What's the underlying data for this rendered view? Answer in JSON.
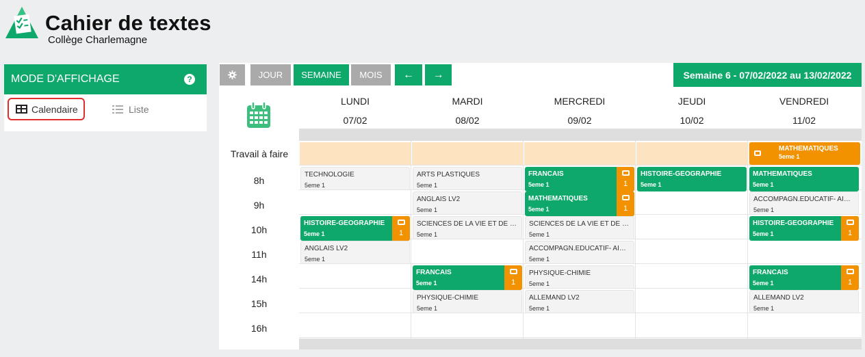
{
  "header": {
    "title": "Cahier de textes",
    "subtitle": "Collège Charlemagne"
  },
  "sidebar": {
    "title": "MODE D'AFFICHAGE",
    "help": "?",
    "views": [
      {
        "label": "Calendaire",
        "icon": "calendar-grid-icon",
        "selected": true
      },
      {
        "label": "Liste",
        "icon": "list-icon",
        "selected": false
      }
    ]
  },
  "toolbar": {
    "settings_icon": "gear-icon",
    "day": "JOUR",
    "week": "SEMAINE",
    "month": "MOIS",
    "prev": "←",
    "next": "→",
    "active_view": "SEMAINE"
  },
  "week_label": "Semaine 6 - 07/02/2022 au 13/02/2022",
  "colors": {
    "accent": "#0fa86b",
    "homework": "#f39200",
    "todo_row": "#fde3c0",
    "selection_outline": "#e22b2b"
  },
  "days": [
    {
      "name": "LUNDI",
      "date": "07/02"
    },
    {
      "name": "MARDI",
      "date": "08/02"
    },
    {
      "name": "MERCREDI",
      "date": "09/02"
    },
    {
      "name": "JEUDI",
      "date": "10/02"
    },
    {
      "name": "VENDREDI",
      "date": "11/02"
    }
  ],
  "rows": {
    "todo": "Travail à faire",
    "hours": [
      "8h",
      "9h",
      "10h",
      "11h",
      "14h",
      "15h",
      "16h"
    ]
  },
  "todo_items": [
    {
      "day": 4,
      "subject": "MATHEMATIQUES",
      "class": "5eme 1"
    }
  ],
  "lessons": [
    {
      "day": 0,
      "slot": 0,
      "subject": "TECHNOLOGIE",
      "class": "5eme 1",
      "homework": null
    },
    {
      "day": 0,
      "slot": 2,
      "subject": "HISTOIRE-GEOGRAPHIE",
      "class": "5eme 1",
      "homework": "1"
    },
    {
      "day": 0,
      "slot": 3,
      "subject": "ANGLAIS LV2",
      "class": "5eme 1",
      "homework": null
    },
    {
      "day": 1,
      "slot": 0,
      "subject": "ARTS PLASTIQUES",
      "class": "5eme 1",
      "homework": null
    },
    {
      "day": 1,
      "slot": 1,
      "subject": "ANGLAIS LV2",
      "class": "5eme 1",
      "homework": null
    },
    {
      "day": 1,
      "slot": 2,
      "subject": "SCIENCES DE LA VIE ET DE LA TER...",
      "class": "5eme 1",
      "homework": null
    },
    {
      "day": 1,
      "slot": 4,
      "subject": "FRANCAIS",
      "class": "5eme 1",
      "homework": "1"
    },
    {
      "day": 1,
      "slot": 5,
      "subject": "PHYSIQUE-CHIMIE",
      "class": "5eme 1",
      "homework": null
    },
    {
      "day": 2,
      "slot": 0,
      "subject": "FRANCAIS",
      "class": "5eme 1",
      "homework": "1"
    },
    {
      "day": 2,
      "slot": 1,
      "subject": "MATHEMATIQUES",
      "class": "5eme 1",
      "homework": "1"
    },
    {
      "day": 2,
      "slot": 2,
      "subject": "SCIENCES DE LA VIE ET DE LA TER...",
      "class": "5eme 1",
      "homework": null
    },
    {
      "day": 2,
      "slot": 3,
      "subject": "ACCOMPAGN.EDUCATIF- AIDE DE...",
      "class": "5eme 1",
      "homework": null
    },
    {
      "day": 2,
      "slot": 4,
      "subject": "PHYSIQUE-CHIMIE",
      "class": "5eme 1",
      "homework": null
    },
    {
      "day": 2,
      "slot": 5,
      "subject": "ALLEMAND LV2",
      "class": "5eme 1",
      "homework": null
    },
    {
      "day": 3,
      "slot": 0,
      "subject": "HISTOIRE-GEOGRAPHIE",
      "class": "5eme 1",
      "homework": ""
    },
    {
      "day": 4,
      "slot": 0,
      "subject": "MATHEMATIQUES",
      "class": "5eme 1",
      "homework": ""
    },
    {
      "day": 4,
      "slot": 1,
      "subject": "ACCOMPAGN.EDUCATIF- AIDE DE...",
      "class": "5eme 1",
      "homework": null
    },
    {
      "day": 4,
      "slot": 2,
      "subject": "HISTOIRE-GEOGRAPHIE",
      "class": "5eme 1",
      "homework": "1"
    },
    {
      "day": 4,
      "slot": 4,
      "subject": "FRANCAIS",
      "class": "5eme 1",
      "homework": "1"
    },
    {
      "day": 4,
      "slot": 5,
      "subject": "ALLEMAND LV2",
      "class": "5eme 1",
      "homework": null
    }
  ]
}
